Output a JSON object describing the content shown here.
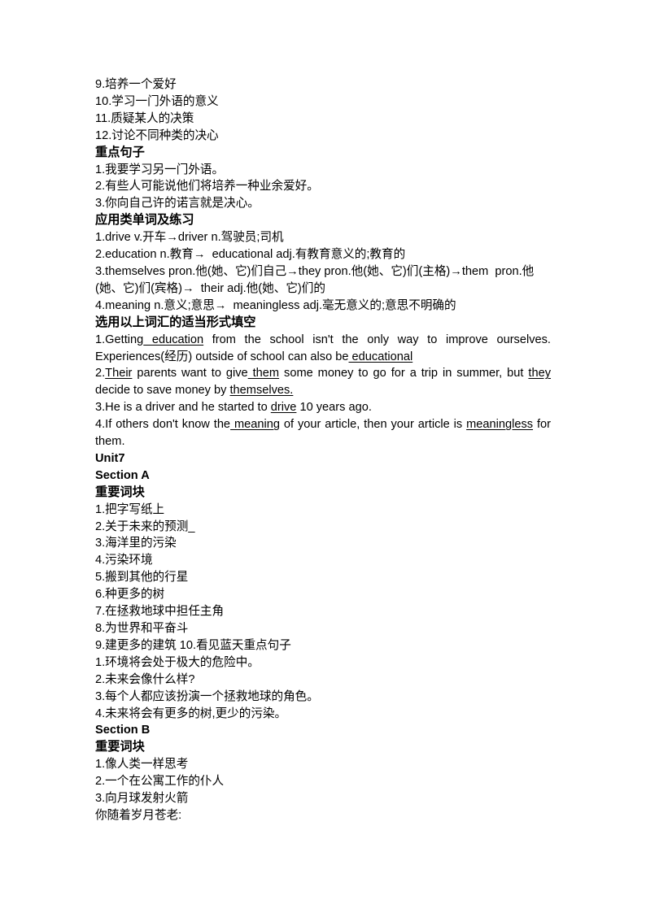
{
  "document": {
    "blocks": [
      {
        "id": "b1",
        "type": "list-item",
        "text": "9.培养一个爱好"
      },
      {
        "id": "b2",
        "type": "list-item",
        "text": "10.学习一门外语的意义"
      },
      {
        "id": "b3",
        "type": "list-item",
        "text": "11.质疑某人的决策"
      },
      {
        "id": "b4",
        "type": "list-item",
        "text": "12.讨论不同种类的决心"
      },
      {
        "id": "b5",
        "type": "heading-cn",
        "text": "重点句子"
      },
      {
        "id": "b6",
        "type": "list-item",
        "text": "1.我要学习另一门外语。"
      },
      {
        "id": "b7",
        "type": "list-item",
        "text": "2.有些人可能说他们将培养一种业余爱好。"
      },
      {
        "id": "b8",
        "type": "list-item",
        "text": "3.你向自己许的诺言就是决心。"
      },
      {
        "id": "b9",
        "type": "heading-cn",
        "text": "应用类单词及练习"
      },
      {
        "id": "b10",
        "type": "list-item",
        "text": "1.drive v.开车→driver n.驾驶员;司机"
      },
      {
        "id": "b11",
        "type": "list-item",
        "text": "2.education n.教育→  educational adj.有教育意义的;教育的"
      },
      {
        "id": "b12",
        "type": "list-item",
        "text": "3.themselves pron.他(她、它)们自己→they pron.他(她、它)们(主格)→them  pron.他(她、它)们(宾格)→  their adj.他(她、它)们的"
      },
      {
        "id": "b13",
        "type": "list-item",
        "text": "4.meaning n.意义;意思→  meaningless adj.毫无意义的;意思不明确的"
      },
      {
        "id": "b14",
        "type": "heading-cn",
        "text": "选用以上词汇的适当形式填空"
      },
      {
        "id": "b15",
        "type": "exercise",
        "segments": [
          {
            "text": "1.Getting",
            "underline": false
          },
          {
            "text": " education",
            "underline": true
          },
          {
            "text": " from the school isn't the only way to improve ourselves. Experiences(经历) outside of school can also be",
            "underline": false
          },
          {
            "text": " educational",
            "underline": true
          }
        ]
      },
      {
        "id": "b16",
        "type": "exercise",
        "segments": [
          {
            "text": "2.",
            "underline": false
          },
          {
            "text": "Their",
            "underline": true
          },
          {
            "text": " parents want to give",
            "underline": false
          },
          {
            "text": " them",
            "underline": true
          },
          {
            "text": " some money to go for a trip in summer, but ",
            "underline": false
          },
          {
            "text": "they",
            "underline": true
          },
          {
            "text": " decide to save money by ",
            "underline": false
          },
          {
            "text": "themselves.",
            "underline": true
          }
        ]
      },
      {
        "id": "b17",
        "type": "exercise",
        "segments": [
          {
            "text": "3.He is a driver and he started to ",
            "underline": false
          },
          {
            "text": "drive",
            "underline": true
          },
          {
            "text": " 10 years ago.",
            "underline": false
          }
        ]
      },
      {
        "id": "b18",
        "type": "exercise",
        "segments": [
          {
            "text": "4.If others don't know the",
            "underline": false
          },
          {
            "text": " meaning",
            "underline": true
          },
          {
            "text": " of your article, then your article is ",
            "underline": false
          },
          {
            "text": "meaningless",
            "underline": true
          },
          {
            "text": " for them.",
            "underline": false
          }
        ]
      },
      {
        "id": "b19",
        "type": "heading-en",
        "text": "Unit7"
      },
      {
        "id": "b20",
        "type": "heading-en",
        "text": "Section A"
      },
      {
        "id": "b21",
        "type": "heading-cn",
        "text": "重要词块"
      },
      {
        "id": "b22",
        "type": "list-item",
        "text": "1.把字写纸上"
      },
      {
        "id": "b23",
        "type": "list-item",
        "text": "2.关于未来的预测_"
      },
      {
        "id": "b24",
        "type": "list-item",
        "text": "3.海洋里的污染"
      },
      {
        "id": "b25",
        "type": "list-item",
        "text": "4.污染环境"
      },
      {
        "id": "b26",
        "type": "list-item",
        "text": "5.搬到其他的行星"
      },
      {
        "id": "b27",
        "type": "list-item",
        "text": "6.种更多的树"
      },
      {
        "id": "b28",
        "type": "list-item",
        "text": "7.在拯救地球中担任主角"
      },
      {
        "id": "b29",
        "type": "list-item",
        "text": "8.为世界和平奋斗"
      },
      {
        "id": "b30",
        "type": "list-item",
        "text": "9.建更多的建筑 10.看见蓝天重点句子"
      },
      {
        "id": "b31",
        "type": "list-item",
        "text": "1.环境将会处于极大的危险中。"
      },
      {
        "id": "b32",
        "type": "list-item",
        "text": "2.未来会像什么样?"
      },
      {
        "id": "b33",
        "type": "list-item",
        "text": "3.每个人都应该扮演一个拯救地球的角色。"
      },
      {
        "id": "b34",
        "type": "list-item",
        "text": "4.未来将会有更多的树,更少的污染。"
      },
      {
        "id": "b35",
        "type": "heading-en",
        "text": "Section B"
      },
      {
        "id": "b36",
        "type": "heading-cn",
        "text": "重要词块"
      },
      {
        "id": "b37",
        "type": "list-item",
        "text": "1.像人类一样思考"
      },
      {
        "id": "b38",
        "type": "list-item",
        "text": "2.一个在公寓工作的仆人"
      },
      {
        "id": "b39",
        "type": "list-item",
        "text": "3.向月球发射火箭"
      },
      {
        "id": "b40",
        "type": "list-item",
        "text": "你随着岁月苍老:"
      }
    ]
  }
}
